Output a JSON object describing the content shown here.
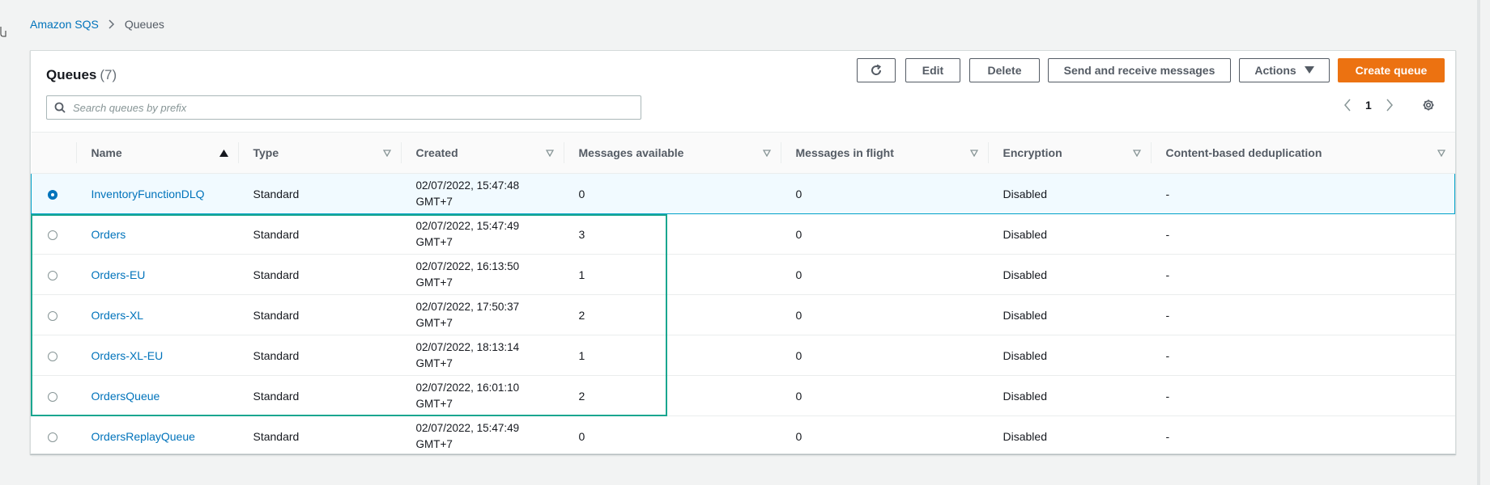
{
  "breadcrumb": {
    "root": "Amazon SQS",
    "current": "Queues"
  },
  "panel": {
    "title": "Queues",
    "count": "(7)",
    "buttons": {
      "edit": "Edit",
      "delete": "Delete",
      "send_receive": "Send and receive messages",
      "actions": "Actions",
      "create": "Create queue"
    },
    "search_placeholder": "Search queues by prefix",
    "page": "1"
  },
  "columns": [
    "Name",
    "Type",
    "Created",
    "Messages available",
    "Messages in flight",
    "Encryption",
    "Content-based deduplication"
  ],
  "rows": [
    {
      "name": "InventoryFunctionDLQ",
      "type": "Standard",
      "created_1": "02/07/2022, 15:47:48",
      "created_2": "GMT+7",
      "available": "0",
      "in_flight": "0",
      "encryption": "Disabled",
      "dedup": "-",
      "selected": true
    },
    {
      "name": "Orders",
      "type": "Standard",
      "created_1": "02/07/2022, 15:47:49",
      "created_2": "GMT+7",
      "available": "3",
      "in_flight": "0",
      "encryption": "Disabled",
      "dedup": "-",
      "selected": false
    },
    {
      "name": "Orders-EU",
      "type": "Standard",
      "created_1": "02/07/2022, 16:13:50",
      "created_2": "GMT+7",
      "available": "1",
      "in_flight": "0",
      "encryption": "Disabled",
      "dedup": "-",
      "selected": false
    },
    {
      "name": "Orders-XL",
      "type": "Standard",
      "created_1": "02/07/2022, 17:50:37",
      "created_2": "GMT+7",
      "available": "2",
      "in_flight": "0",
      "encryption": "Disabled",
      "dedup": "-",
      "selected": false
    },
    {
      "name": "Orders-XL-EU",
      "type": "Standard",
      "created_1": "02/07/2022, 18:13:14",
      "created_2": "GMT+7",
      "available": "1",
      "in_flight": "0",
      "encryption": "Disabled",
      "dedup": "-",
      "selected": false
    },
    {
      "name": "OrdersQueue",
      "type": "Standard",
      "created_1": "02/07/2022, 16:01:10",
      "created_2": "GMT+7",
      "available": "2",
      "in_flight": "0",
      "encryption": "Disabled",
      "dedup": "-",
      "selected": false
    },
    {
      "name": "OrdersReplayQueue",
      "type": "Standard",
      "created_1": "02/07/2022, 15:47:49",
      "created_2": "GMT+7",
      "available": "0",
      "in_flight": "0",
      "encryption": "Disabled",
      "dedup": "-",
      "selected": false
    }
  ],
  "icons": {
    "refresh": "refresh-icon",
    "search": "search-icon",
    "settings": "gear-icon",
    "sort_asc": "sort-ascending-icon",
    "sort": "sort-icon"
  },
  "colors": {
    "primary": "#ec7211",
    "link": "#0073bb",
    "selected_border": "#00a1c9",
    "highlight": "#1aa690"
  }
}
